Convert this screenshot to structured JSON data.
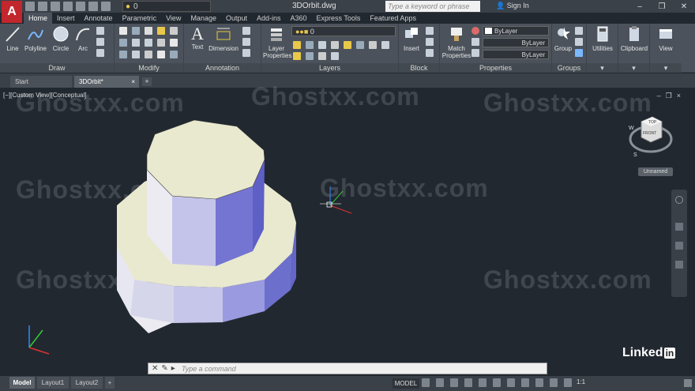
{
  "app": {
    "logo": "A",
    "title": "3DOrbit.dwg",
    "workspace_value": "0"
  },
  "search": {
    "placeholder": "Type a keyword or phrase"
  },
  "account": {
    "signin": "Sign In"
  },
  "ribbon_tabs": [
    "Home",
    "Insert",
    "Annotate",
    "Parametric",
    "View",
    "Manage",
    "Output",
    "Add-ins",
    "A360",
    "Express Tools",
    "Featured Apps"
  ],
  "ribbon": {
    "draw": {
      "title": "Draw",
      "line": "Line",
      "polyline": "Polyline",
      "circle": "Circle",
      "arc": "Arc"
    },
    "modify": {
      "title": "Modify"
    },
    "annotation": {
      "title": "Annotation",
      "text": "Text",
      "dimension": "Dimension"
    },
    "layers": {
      "title": "Layers",
      "layer_properties": "Layer Properties",
      "layer_value": "0"
    },
    "block": {
      "title": "Block",
      "insert": "Insert"
    },
    "properties": {
      "title": "Properties",
      "match": "Match Properties",
      "bylayer1": "ByLayer",
      "bylayer2": "ByLayer",
      "bylayer3": "ByLayer"
    },
    "groups": {
      "title": "Groups",
      "group": "Group"
    },
    "utilities": "Utilities",
    "clipboard": "Clipboard",
    "view": "View"
  },
  "file_tabs": {
    "start": "Start",
    "current": "3DOrbit*"
  },
  "viewport": {
    "label": "[−][Custom View][Conceptual]",
    "viewcube": {
      "top": "TOP",
      "front": "FRONT",
      "w": "W",
      "s": "S"
    },
    "named_view": "Unnamed",
    "watermark": "Ghostxx.com"
  },
  "command": {
    "placeholder": "Type a command"
  },
  "layout_tabs": [
    "Model",
    "Layout1",
    "Layout2"
  ],
  "status": {
    "model": "MODEL",
    "scale": "1:1"
  },
  "brand": {
    "name": "Linked",
    "in": "in"
  },
  "colors": {
    "accent": "#c1272d",
    "solid_top": "#e9e9d0",
    "solid_side": "#6d6fcc"
  }
}
